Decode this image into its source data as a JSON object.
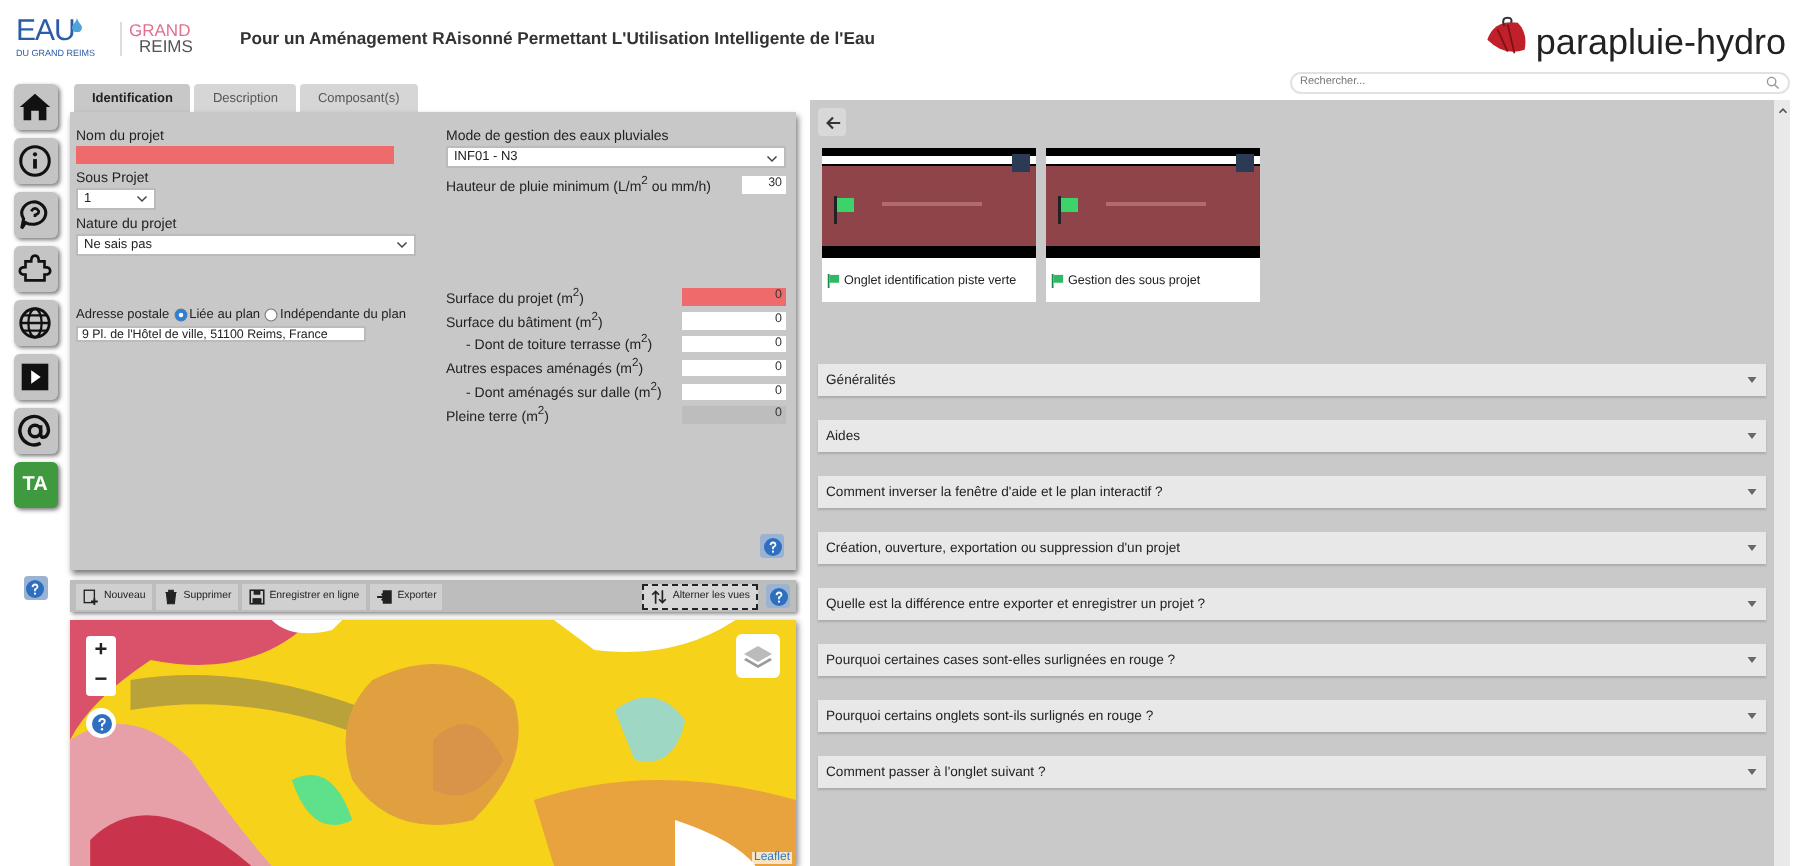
{
  "header": {
    "logo_left": {
      "brand": "EAU",
      "brand_sub": "DU GRAND REIMS",
      "partner_line1": "GRAND",
      "partner_line2": "REIMS"
    },
    "title": "Pour un Aménagement RAisonné Permettant L'Utilisation Intelligente de l'Eau",
    "logo_right": "parapluie-hydro"
  },
  "sidebar": {
    "items": [
      {
        "kind": "home"
      },
      {
        "kind": "info"
      },
      {
        "kind": "help"
      },
      {
        "kind": "puzzle"
      },
      {
        "kind": "globe"
      },
      {
        "kind": "video"
      },
      {
        "kind": "at"
      },
      {
        "kind": "text",
        "label": "TA"
      }
    ]
  },
  "tabs": [
    {
      "label": "Identification",
      "selected": true
    },
    {
      "label": "Description",
      "selected": false
    },
    {
      "label": "Composant(s)",
      "selected": false
    }
  ],
  "form": {
    "project_name": {
      "label": "Nom du projet",
      "invalid": true
    },
    "sub_project": {
      "label": "Sous Projet",
      "value": "1"
    },
    "nature": {
      "label": "Nature du projet",
      "value": "Ne sais pas"
    },
    "address": {
      "label": "Adresse postale",
      "options": [
        {
          "label": "Liée au plan",
          "selected": true
        },
        {
          "label": "Indépendante du plan",
          "selected": false
        }
      ],
      "value": "9 Pl. de l'Hôtel de ville, 51100 Reims, France"
    },
    "mode": {
      "label": "Mode de gestion des eaux pluviales",
      "value": "INF01 - N3"
    },
    "rain": {
      "label": "Hauteur de pluie minimum (L/m$^{2}$ ou mm/h)",
      "value": "30"
    },
    "surfaces": [
      {
        "label": "Surface du projet (m$^{2}$)",
        "value": "0",
        "indented": false,
        "invalid": true,
        "disabled": false
      },
      {
        "label": "Surface du bâtiment (m$^{2}$)",
        "value": "0",
        "indented": false,
        "invalid": false,
        "disabled": false
      },
      {
        "label": "- Dont de toiture terrasse (m$^{2}$)",
        "value": "0",
        "indented": true,
        "invalid": false,
        "disabled": false
      },
      {
        "label": "Autres espaces aménagés (m$^{2}$)",
        "value": "0",
        "indented": false,
        "invalid": false,
        "disabled": false
      },
      {
        "label": "- Dont aménagés sur dalle (m$^{2}$)",
        "value": "0",
        "indented": true,
        "invalid": false,
        "disabled": false
      },
      {
        "label": "Pleine terre (m$^{2}$)",
        "value": "0",
        "indented": false,
        "invalid": false,
        "disabled": true
      }
    ]
  },
  "toolbar": [
    {
      "kind": "new",
      "label": "Nouveau"
    },
    {
      "kind": "delete",
      "label": "Supprimer"
    },
    {
      "kind": "save",
      "label": "Enregistrer en ligne"
    },
    {
      "kind": "export",
      "label": "Exporter"
    },
    {
      "kind": "swap",
      "label": "Alterner les vues"
    }
  ],
  "map": {
    "zoom_in": "+",
    "zoom_out": "−",
    "attribution": "Leaflet"
  },
  "help_panel": {
    "search": {
      "placeholder": "Rechercher..."
    },
    "videos": [
      {
        "caption": "Onglet identification piste verte"
      },
      {
        "caption": "Gestion des sous projet"
      }
    ],
    "faq": [
      {
        "title": "Généralités"
      },
      {
        "title": "Aides"
      },
      {
        "title": "Comment inverser la fenêtre d'aide et le plan interactif ?"
      },
      {
        "title": "Création, ouverture, exportation ou suppression d'un projet"
      },
      {
        "title": "Quelle est la différence entre exporter et enregistrer un projet ?"
      },
      {
        "title": "Pourquoi certaines cases sont-elles surlignées en rouge ?"
      },
      {
        "title": "Pourquoi certains onglets sont-ils surlignés en rouge ?"
      },
      {
        "title": "Comment passer à l'onglet suivant ?"
      }
    ]
  }
}
